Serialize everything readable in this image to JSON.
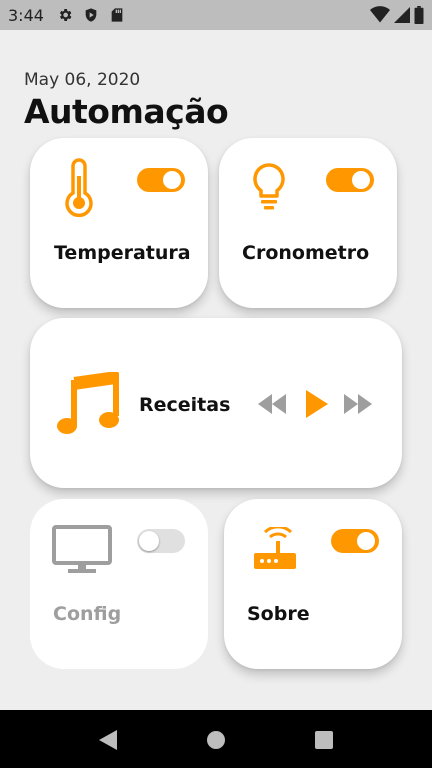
{
  "status_bar": {
    "time": "3:44",
    "icons": [
      "gear-icon",
      "play-protect-icon",
      "sd-card-icon",
      "wifi-icon",
      "signal-icon",
      "battery-icon"
    ]
  },
  "header": {
    "date": "May 06, 2020",
    "title": "Automação"
  },
  "colors": {
    "accent": "#ff9800",
    "card_bg": "#ffffff",
    "background": "#eeeeee",
    "muted": "#9e9e9e"
  },
  "cards": {
    "temperatura": {
      "label": "Temperatura",
      "icon": "thermometer-icon",
      "toggle_on": true
    },
    "cronometro": {
      "label": "Cronometro",
      "icon": "lightbulb-icon",
      "toggle_on": true
    },
    "receitas": {
      "label": "Receitas",
      "icon": "music-note-icon",
      "controls": [
        "rewind-icon",
        "play-icon",
        "fast-forward-icon"
      ]
    },
    "config": {
      "label": "Config",
      "icon": "monitor-icon",
      "toggle_on": false
    },
    "sobre": {
      "label": "Sobre",
      "icon": "router-icon",
      "toggle_on": true
    }
  },
  "nav_bar": {
    "buttons": [
      "back-icon",
      "home-icon",
      "recents-icon"
    ]
  }
}
